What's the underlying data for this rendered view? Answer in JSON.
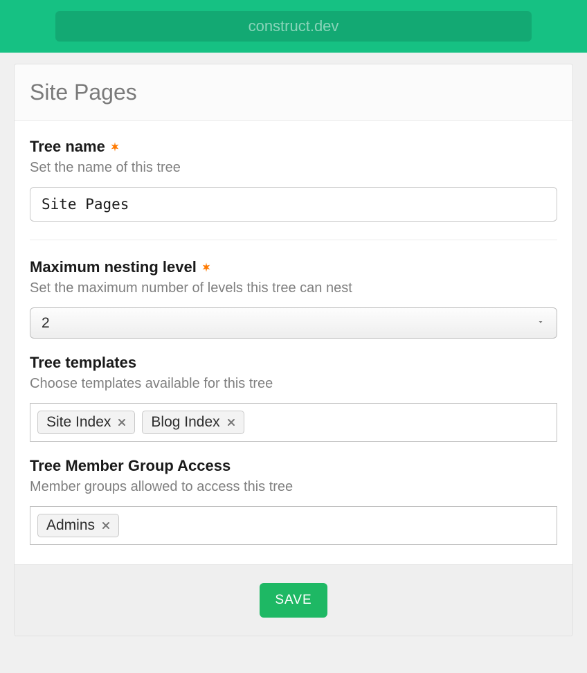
{
  "url_bar": "construct.dev",
  "panel": {
    "title": "Site Pages"
  },
  "fields": {
    "tree_name": {
      "label": "Tree name",
      "required": true,
      "description": "Set the name of this tree",
      "value": "Site Pages"
    },
    "max_nesting": {
      "label": "Maximum nesting level",
      "required": true,
      "description": "Set the maximum number of levels this tree can nest",
      "value": "2"
    },
    "tree_templates": {
      "label": "Tree templates",
      "required": false,
      "description": "Choose templates available for this tree",
      "tags": [
        "Site Index",
        "Blog Index"
      ]
    },
    "member_access": {
      "label": "Tree Member Group Access",
      "required": false,
      "description": "Member groups allowed to access this tree",
      "tags": [
        "Admins"
      ]
    }
  },
  "footer": {
    "save_label": "SAVE"
  }
}
